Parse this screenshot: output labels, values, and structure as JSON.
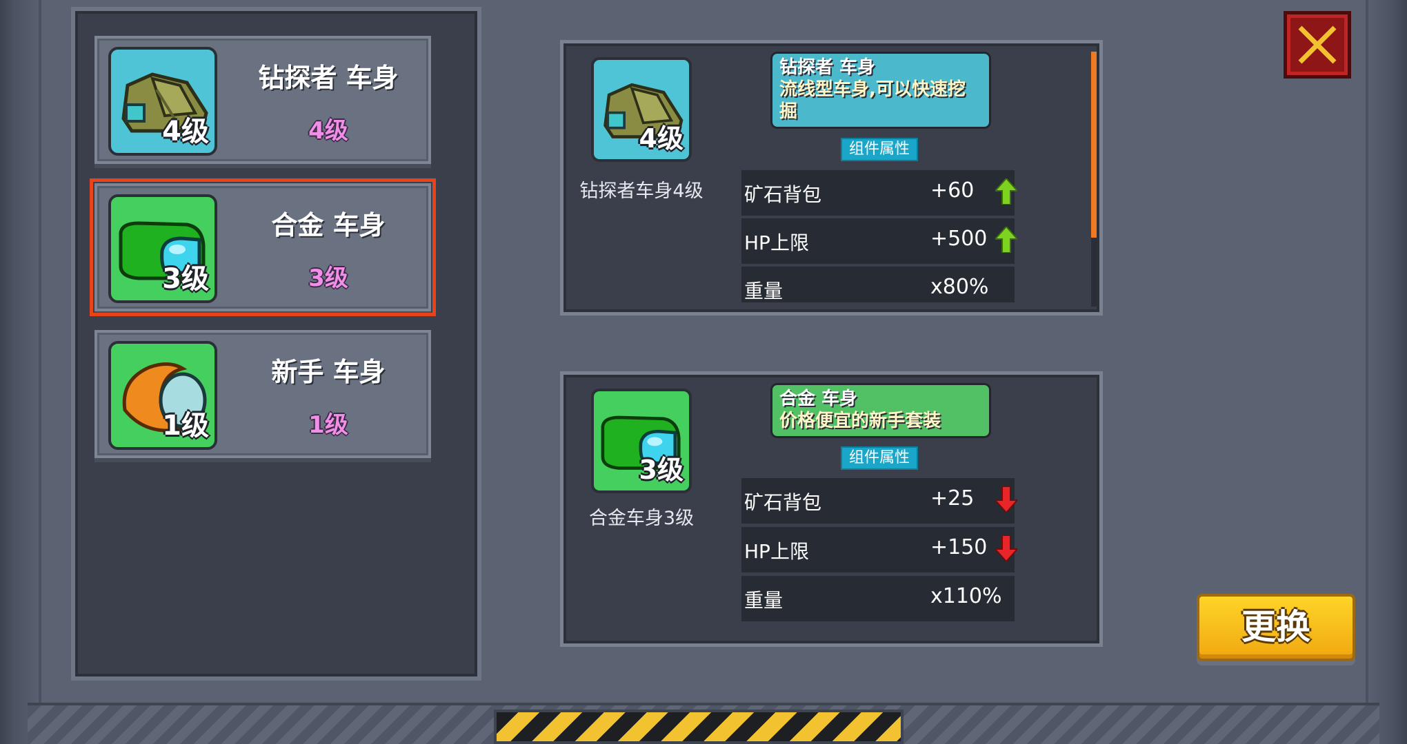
{
  "parts_list": [
    {
      "name": "钻探者 车身",
      "level": "4级",
      "thumb_level": "4级",
      "icon": "drill-body-icon",
      "bg": "#4fc4d6",
      "selected": false
    },
    {
      "name": "合金 车身",
      "level": "3级",
      "thumb_level": "3级",
      "icon": "alloy-body-icon",
      "bg": "#45cf5e",
      "selected": true
    },
    {
      "name": "新手 车身",
      "level": "1级",
      "thumb_level": "1级",
      "icon": "novice-body-icon",
      "bg": "#45cf5e",
      "selected": false
    }
  ],
  "detail_top": {
    "thumb_level": "4级",
    "caption": "钻探者车身4级",
    "desc_title": "钻探者 车身",
    "desc_text": "流线型车身,可以快速挖掘",
    "attr_tag": "组件属性",
    "stats": [
      {
        "label": "矿石背包",
        "value": "+60",
        "trend": "up"
      },
      {
        "label": "HP上限",
        "value": "+500",
        "trend": "up"
      },
      {
        "label": "重量",
        "value": "x80%",
        "trend": "none"
      }
    ]
  },
  "detail_bottom": {
    "thumb_level": "3级",
    "caption": "合金车身3级",
    "desc_title": "合金 车身",
    "desc_text": "价格便宜的新手套装",
    "attr_tag": "组件属性",
    "stats": [
      {
        "label": "矿石背包",
        "value": "+25",
        "trend": "down"
      },
      {
        "label": "HP上限",
        "value": "+150",
        "trend": "down"
      },
      {
        "label": "重量",
        "value": "x110%",
        "trend": "none"
      }
    ]
  },
  "buttons": {
    "swap": "更换",
    "close_icon": "close-icon"
  },
  "colors": {
    "up_arrow": "#7ed321",
    "down_arrow": "#e8262a",
    "level_text": "#f08ee8",
    "selected_outline": "#e8431a"
  }
}
